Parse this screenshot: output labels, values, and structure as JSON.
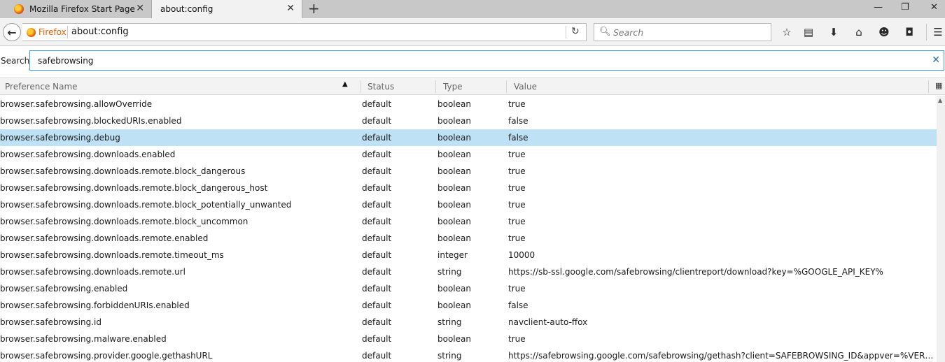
{
  "tabs": [
    {
      "title": "Mozilla Firefox Start Page",
      "active": false
    },
    {
      "title": "about:config",
      "active": true
    }
  ],
  "window_controls": {
    "minimize": "—",
    "restore": "❐",
    "close": "✕"
  },
  "urlbar": {
    "identity_label": "Firefox",
    "url": "about:config"
  },
  "search": {
    "placeholder": "Search"
  },
  "filter": {
    "label": "Search:",
    "value": "safebrowsing"
  },
  "columns": {
    "name": "Preference Name",
    "status": "Status",
    "type": "Type",
    "value": "Value"
  },
  "preferences": [
    {
      "name": "browser.safebrowsing.allowOverride",
      "status": "default",
      "type": "boolean",
      "value": "true"
    },
    {
      "name": "browser.safebrowsing.blockedURIs.enabled",
      "status": "default",
      "type": "boolean",
      "value": "false"
    },
    {
      "name": "browser.safebrowsing.debug",
      "status": "default",
      "type": "boolean",
      "value": "false",
      "selected": true
    },
    {
      "name": "browser.safebrowsing.downloads.enabled",
      "status": "default",
      "type": "boolean",
      "value": "true"
    },
    {
      "name": "browser.safebrowsing.downloads.remote.block_dangerous",
      "status": "default",
      "type": "boolean",
      "value": "true"
    },
    {
      "name": "browser.safebrowsing.downloads.remote.block_dangerous_host",
      "status": "default",
      "type": "boolean",
      "value": "true"
    },
    {
      "name": "browser.safebrowsing.downloads.remote.block_potentially_unwanted",
      "status": "default",
      "type": "boolean",
      "value": "true"
    },
    {
      "name": "browser.safebrowsing.downloads.remote.block_uncommon",
      "status": "default",
      "type": "boolean",
      "value": "true"
    },
    {
      "name": "browser.safebrowsing.downloads.remote.enabled",
      "status": "default",
      "type": "boolean",
      "value": "true"
    },
    {
      "name": "browser.safebrowsing.downloads.remote.timeout_ms",
      "status": "default",
      "type": "integer",
      "value": "10000"
    },
    {
      "name": "browser.safebrowsing.downloads.remote.url",
      "status": "default",
      "type": "string",
      "value": "https://sb-ssl.google.com/safebrowsing/clientreport/download?key=%GOOGLE_API_KEY%"
    },
    {
      "name": "browser.safebrowsing.enabled",
      "status": "default",
      "type": "boolean",
      "value": "true"
    },
    {
      "name": "browser.safebrowsing.forbiddenURIs.enabled",
      "status": "default",
      "type": "boolean",
      "value": "false"
    },
    {
      "name": "browser.safebrowsing.id",
      "status": "default",
      "type": "string",
      "value": "navclient-auto-ffox"
    },
    {
      "name": "browser.safebrowsing.malware.enabled",
      "status": "default",
      "type": "boolean",
      "value": "true"
    },
    {
      "name": "browser.safebrowsing.provider.google.gethashURL",
      "status": "default",
      "type": "string",
      "value": "https://safebrowsing.google.com/safebrowsing/gethash?client=SAFEBROWSING_ID&appver=%VERSION%&pver=..."
    }
  ],
  "colors": {
    "selected_row": "#bfe1f5",
    "focus_border": "#3c9ad8",
    "identity": "#e66000"
  },
  "icons": [
    "firefox-logo",
    "close-icon",
    "plus-icon",
    "back-arrow-icon",
    "reload-icon",
    "search-icon",
    "star-icon",
    "reading-list-icon",
    "download-icon",
    "home-icon",
    "hello-icon",
    "pocket-icon",
    "hamburger-menu-icon",
    "sort-ascending-icon",
    "column-picker-icon"
  ]
}
